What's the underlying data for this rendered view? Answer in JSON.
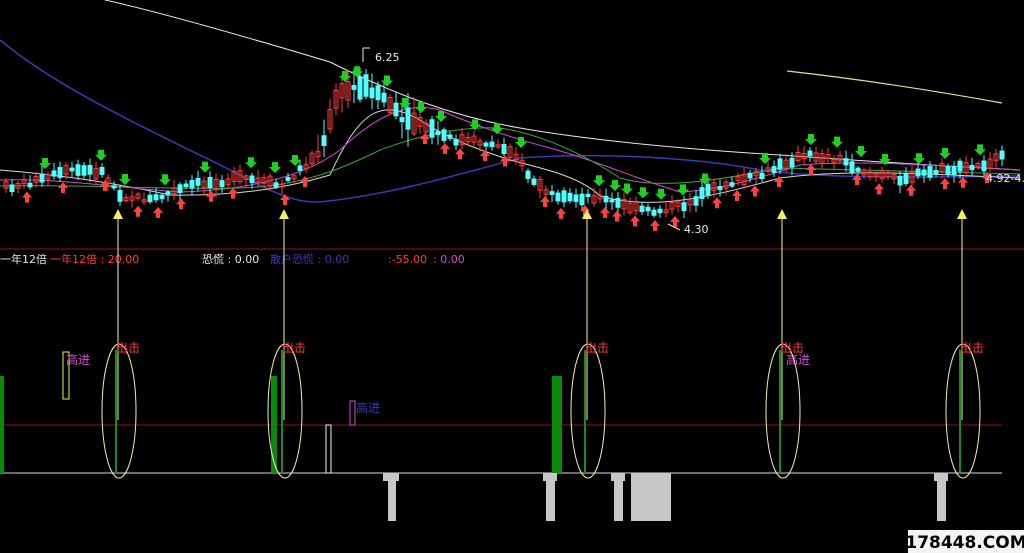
{
  "chart_data": {
    "type": "candlestick",
    "price_annotations": {
      "high": "6.25",
      "low": "4.30",
      "right_edge": "4.92-4."
    },
    "indicator_header": {
      "name": "一年12倍",
      "series_label": "一年12倍",
      "series_value": "20.00",
      "panic_label": "恐慌",
      "panic_value": "0.00",
      "mid_label": "散户恐慌",
      "mid_value": "0.00",
      "neg_value": ":-55.00",
      "last_value": ": 0.00"
    },
    "signals": {
      "strike": "出击",
      "buy": "高进"
    },
    "colors": {
      "up": "#ff3b3b",
      "down": "#54ffff",
      "ma_blue": "#3a3ab4",
      "ma_white": "#e8e8e8",
      "ma_pink": "#d24bd2",
      "ma_green": "#3aa83a",
      "ma_yellow": "#e0e090",
      "arrow_up": "#ff4040",
      "arrow_down": "#20d020",
      "sep": "#9a1010",
      "yellow": "#f0f060"
    },
    "strike_positions": [
      118,
      284,
      587,
      782,
      962
    ]
  },
  "watermark": "178448.COM"
}
